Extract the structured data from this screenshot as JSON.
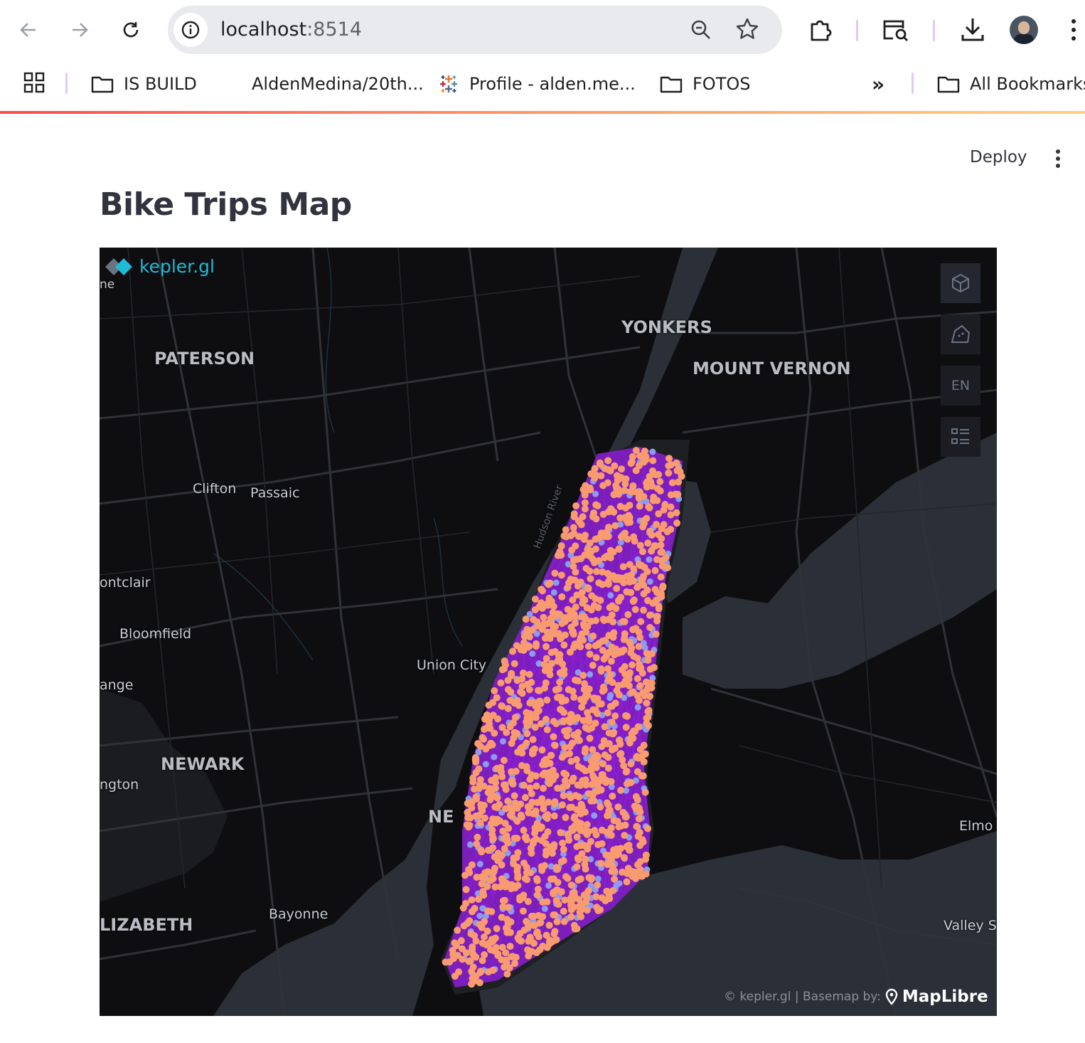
{
  "browser": {
    "url_host": "localhost",
    "url_port": ":8514",
    "bookmarks": [
      {
        "label": "IS BUILD",
        "icon": "folder-icon"
      },
      {
        "label": "AldenMedina/20th...",
        "icon": "github-icon"
      },
      {
        "label": "Profile - alden.me...",
        "icon": "tableau-icon"
      },
      {
        "label": "FOTOS",
        "icon": "folder-icon"
      }
    ],
    "all_bookmarks": "All Bookmarks",
    "overflow": "»"
  },
  "app": {
    "deploy_label": "Deploy",
    "title": "Bike Trips Map"
  },
  "map": {
    "brand": "kepler.gl",
    "lang_control": "EN",
    "attribution": "© kepler.gl | Basemap by:",
    "basemap_brand": "MapLibre",
    "place_labels": [
      "ne",
      "PATERSON",
      "YONKERS",
      "MOUNT VERNON",
      "Clifton",
      "Passaic",
      "Hudson River",
      "ontclair",
      "Bloomfield",
      "Union City",
      "ange",
      "NEWARK",
      "ngton",
      "NE",
      "Elmo",
      "Bayonne",
      "LIZABETH",
      "Valley S"
    ],
    "colors": {
      "background": "#0e0e10",
      "water": "#2b3038",
      "arcs": "#8d1fd6",
      "points_origin": "#f99b70",
      "points_dest": "#8a9bf0",
      "brand": "#1fbad6"
    }
  }
}
